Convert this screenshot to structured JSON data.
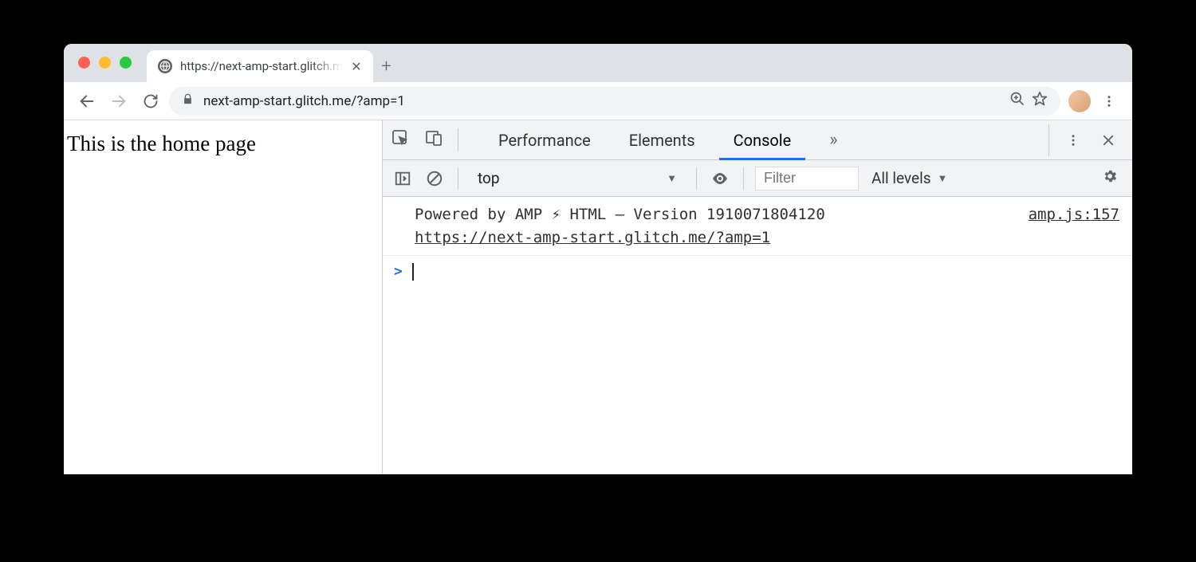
{
  "browser": {
    "tab_title": "https://next-amp-start.glitch.m",
    "new_tab_glyph": "+",
    "url": "next-amp-start.glitch.me/?amp=1"
  },
  "page": {
    "body_text": "This is the home page"
  },
  "devtools": {
    "tabs": {
      "performance": "Performance",
      "elements": "Elements",
      "console": "Console",
      "overflow": "»"
    },
    "console_toolbar": {
      "context": "top",
      "filter_placeholder": "Filter",
      "levels_label": "All levels"
    },
    "log": {
      "line1": "Powered by AMP ⚡ HTML – Version 1910071804120",
      "line2_url": "https://next-amp-start.glitch.me/?amp=1",
      "source": "amp.js:157"
    },
    "prompt": ">"
  }
}
